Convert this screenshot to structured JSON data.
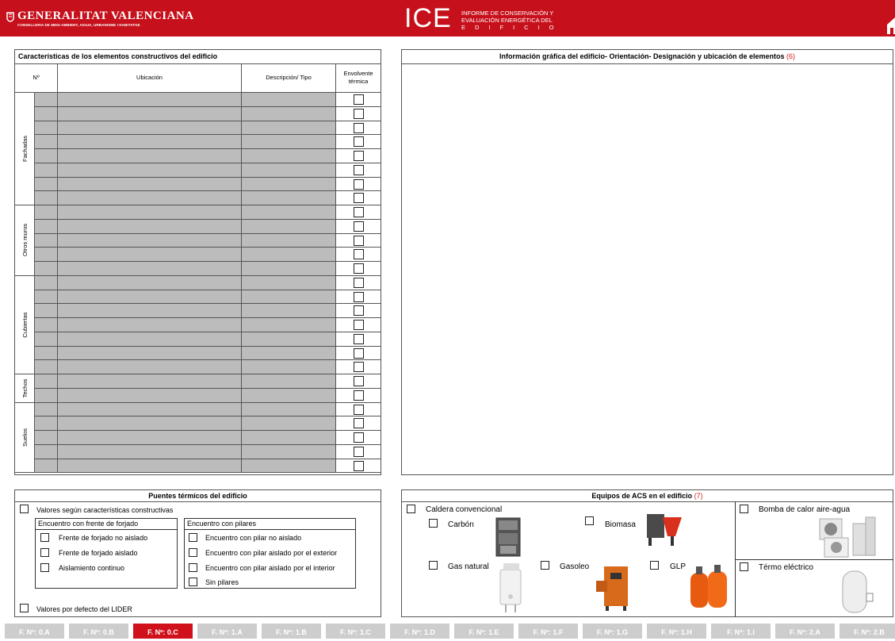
{
  "header": {
    "org_title": "GENERALITAT VALENCIANA",
    "org_subtitle": "CONSELLERIA DE MEDI AMBIENT, AIGUA, URBANISME I HABITATGE",
    "ice_logo": "ICE",
    "ice_line1": "INFORME DE CONSERVACIÓN Y",
    "ice_line2": "EVALUACIÓN ENERGÉTICA DEL",
    "ice_line3": "EDIFICIO",
    "colors": {
      "brand": "#c6101b",
      "active_tab": "#d0101b",
      "inactive_tab": "#cdcdcd",
      "cell_fill": "#bcbcbc",
      "reference": "#d42020"
    }
  },
  "elements_table": {
    "title": "Características de los elementos constructivos del edificio",
    "columns": [
      "Nº",
      "Ubicación",
      "Descripción/ Tipo",
      "Envolvente térmica"
    ],
    "groups": [
      {
        "label": "Fachadas",
        "rows": 8
      },
      {
        "label": "Otros muros",
        "rows": 5
      },
      {
        "label": "Cubiertas",
        "rows": 7
      },
      {
        "label": "Techos",
        "rows": 2
      },
      {
        "label": "Suelos",
        "rows": 5
      }
    ]
  },
  "graphic_info": {
    "title": "Información gráfica del edificio- Orientación- Designación y ubicación de elementos",
    "ref": "(6)"
  },
  "thermal_bridges": {
    "title": "Puentes térmicos del edificio",
    "option_constructive": "Valores según características constructivas",
    "forjado": {
      "title": "Encuentro con frente de forjado",
      "items": [
        "Frente de forjado no aislado",
        "Frente de forjado aislado",
        "Aislamiento continuo"
      ]
    },
    "pilares": {
      "title": "Encuentro con pilares",
      "items": [
        "Encuentro con pilar no aislado",
        "Encuentro con pilar aislado por el exterior",
        "Encuentro con pilar aislado por el interior",
        "Sin pilares"
      ]
    },
    "option_lider": "Valores por defecto del LIDER"
  },
  "acs": {
    "title": "Equipos de ACS en el edificio",
    "ref": "(7)",
    "caldera": "Caldera convencional",
    "carbon": "Carbón",
    "biomasa": "Biomasa",
    "gas_natural": "Gas natural",
    "gasoleo": "Gasoleo",
    "glp": "GLP",
    "bomba": "Bomba de calor aire-agua",
    "termo": "Térmo eléctrico"
  },
  "tabs": [
    "F. Nº: 0.A",
    "F. Nº: 0.B",
    "F. Nº: 0.C",
    "F. Nº: 1.A",
    "F. Nº: 1.B",
    "F. Nº: 1.C",
    "F. Nº: 1.D",
    "F. Nº: 1.E",
    "F. Nº: 1.F",
    "F. Nº: 1.G",
    "F. Nº: 1.H",
    "F. Nº: 1.I",
    "F. Nº: 2.A",
    "F. Nº: 2.B"
  ],
  "active_tab": "F. Nº: 0.C"
}
